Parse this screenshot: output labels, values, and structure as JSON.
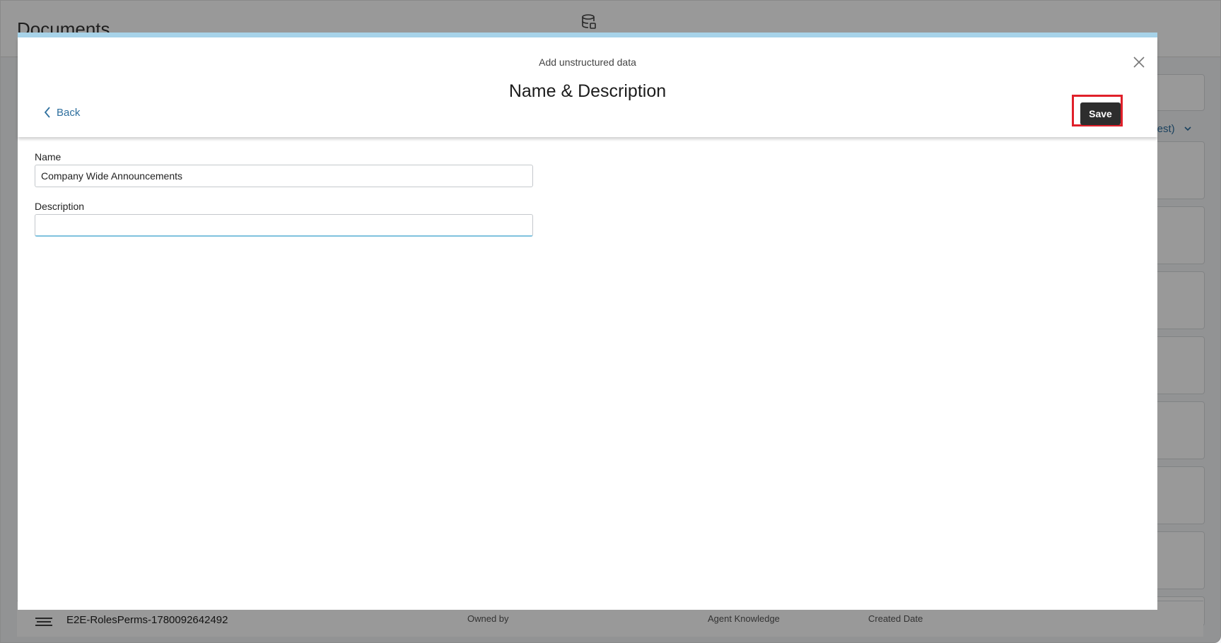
{
  "background": {
    "page_title": "Documents",
    "sort_label": "ldest)",
    "row": {
      "name": "E2E-RolesPerms-1780092642492",
      "owned_by_label": "Owned by",
      "agent_knowledge_label": "Agent Knowledge",
      "created_date_label": "Created Date"
    }
  },
  "modal": {
    "subtitle": "Add unstructured data",
    "title": "Name & Description",
    "back_label": "Back",
    "save_label": "Save",
    "fields": {
      "name": {
        "label": "Name",
        "value": "Company Wide Announcements"
      },
      "description": {
        "label": "Description",
        "value": ""
      }
    }
  },
  "colors": {
    "accent_link": "#2e6f9e",
    "modal_top_bar": "#a7d3e9",
    "save_button": "#2d2d2d",
    "highlight": "#e0202a"
  },
  "icons": {
    "database": "database-icon",
    "close": "close-icon",
    "back": "chevron-left-icon",
    "sort": "chevron-down-icon",
    "row": "stack-icon"
  }
}
